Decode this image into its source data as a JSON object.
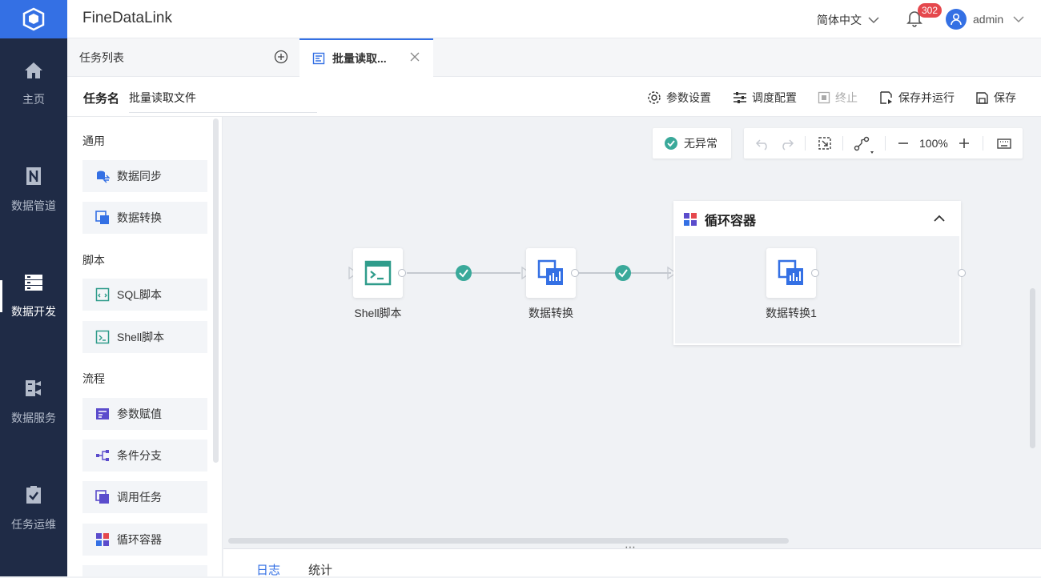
{
  "app": {
    "title": "FineDataLink"
  },
  "nav": {
    "items": [
      {
        "label": "主页",
        "icon": "home-icon"
      },
      {
        "label": "数据管道",
        "icon": "pipeline-icon"
      },
      {
        "label": "数据开发",
        "icon": "data-dev-icon",
        "active": true
      },
      {
        "label": "数据服务",
        "icon": "data-service-icon"
      },
      {
        "label": "任务运维",
        "icon": "task-ops-icon"
      }
    ]
  },
  "header": {
    "language": "简体中文",
    "notification_count": "302",
    "user": "admin"
  },
  "tabs": {
    "task_list": "任务列表",
    "active_tab": "批量读取..."
  },
  "task": {
    "name_label": "任务名",
    "name_value": "批量读取文件",
    "tools": {
      "params": "参数设置",
      "schedule": "调度配置",
      "stop": "终止",
      "save_run": "保存并运行",
      "save": "保存"
    }
  },
  "panel": {
    "groups": [
      {
        "title": "通用",
        "items": [
          "数据同步",
          "数据转换"
        ]
      },
      {
        "title": "脚本",
        "items": [
          "SQL脚本",
          "Shell脚本"
        ]
      },
      {
        "title": "流程",
        "items": [
          "参数赋值",
          "条件分支",
          "调用任务",
          "循环容器"
        ]
      }
    ]
  },
  "canvas": {
    "status": "无异常",
    "zoom": "100%",
    "nodes": {
      "shell": "Shell脚本",
      "transform": "数据转换",
      "transform1": "数据转换1"
    },
    "container_title": "循环容器"
  },
  "bottom_tabs": {
    "log": "日志",
    "stats": "统计"
  },
  "colors": {
    "accent": "#3470e4",
    "nav_bg": "#1f2b46",
    "success": "#3aa99a"
  }
}
